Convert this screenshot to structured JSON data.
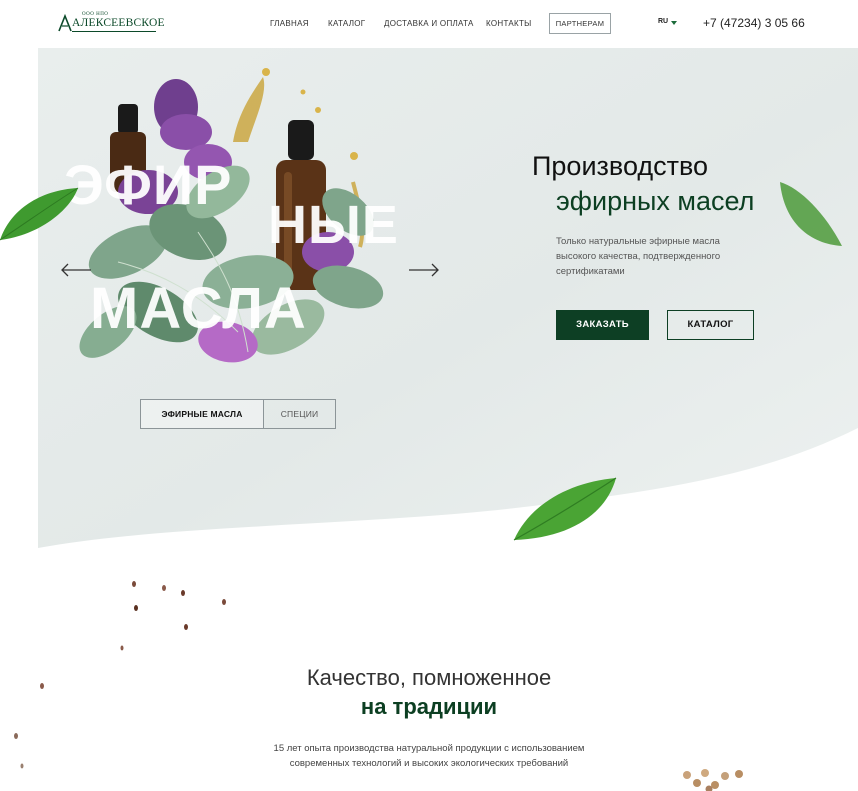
{
  "header": {
    "logo_top": "ООО НПО",
    "logo_name": "АЛЕКСЕЕВСКОЕ",
    "nav": [
      "ГЛАВНАЯ",
      "КАТАЛОГ",
      "ДОСТАВКА И ОПЛАТА",
      "КОНТАКТЫ"
    ],
    "partners_label": "ПАРТНЕРАМ",
    "language": "RU",
    "phone": "+7 (47234) 3 05 66"
  },
  "hero": {
    "big_words": [
      "ЭФИР",
      "НЫЕ",
      "МАСЛА"
    ],
    "tabs": [
      "ЭФИРНЫЕ МАСЛА",
      "СПЕЦИИ"
    ],
    "title_line1": "Производство",
    "title_line2": "эфирных масел",
    "description": "Только натуральные эфирные масла высокого качества, подтвержденного сертификатами",
    "order_label": "ЗАКАЗАТЬ",
    "catalog_label": "КАТАЛОГ"
  },
  "quality": {
    "title_line1": "Качество, помноженное",
    "title_line2": "на традиции",
    "text_line1": "15 лет опыта производства натуральной продукции с использованием",
    "text_line2": "современных технологий и высоких экологических требований"
  },
  "colors": {
    "brand_dark_green": "#0d3f24",
    "hero_bg": "#e6eceb",
    "accent_green": "#1b6b3a"
  }
}
